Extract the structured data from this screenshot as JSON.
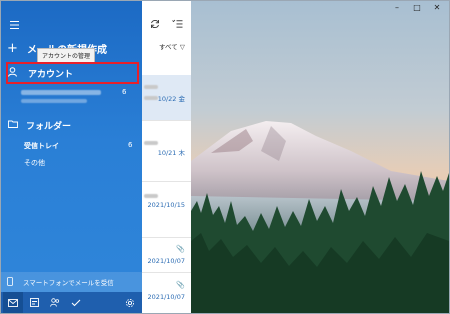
{
  "nav": {
    "new_mail": "メールの新規作成",
    "tooltip": "アカウントの管理",
    "account_header": "アカウント",
    "account_unread": "6",
    "folders_header": "フォルダー",
    "inbox_label": "受信トレイ",
    "inbox_count": "6",
    "other_label": "その他",
    "phone_link": "スマートフォンでメールを受信"
  },
  "list": {
    "filter_label": "すべて ▽",
    "dates": [
      "10/22 金",
      "10/21 木",
      "2021/10/15",
      "2021/10/07",
      "2021/10/07"
    ]
  },
  "icons": {
    "menu": "hamburger-icon",
    "sync": "sync-icon",
    "select": "select-mode-icon",
    "attachment": "paperclip-icon"
  },
  "colors": {
    "nav_bg": "#2a7fd6",
    "highlight": "#e8202a",
    "date_text": "#2a6bb3"
  }
}
